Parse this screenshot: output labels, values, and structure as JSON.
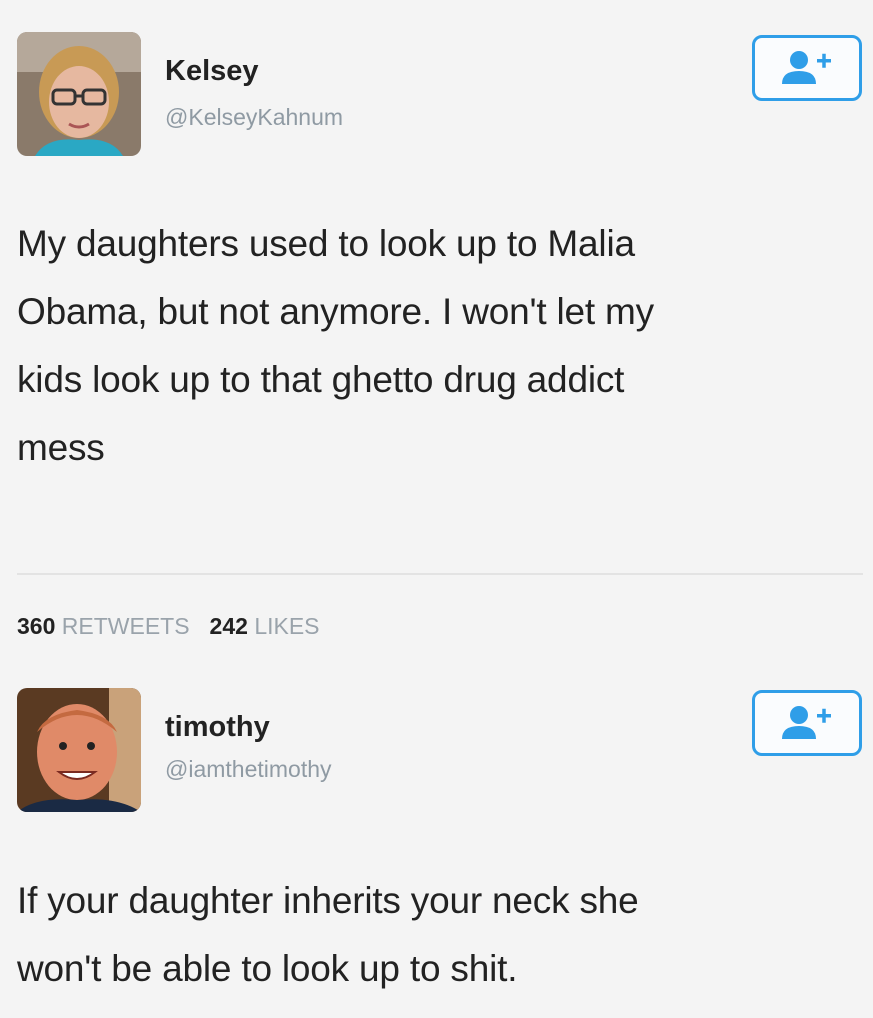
{
  "tweets": [
    {
      "author": {
        "name": "Kelsey",
        "handle": "@KelseyKahnum"
      },
      "follow_icon": "follow-user-icon",
      "text_lines": [
        "My daughters used to look up to Malia",
        "Obama, but not anymore. I won't let my",
        "kids look up to that ghetto drug addict",
        "mess"
      ],
      "stats": {
        "retweets_count": "360",
        "retweets_label": "RETWEETS",
        "likes_count": "242",
        "likes_label": "LIKES"
      }
    },
    {
      "author": {
        "name": "timothy",
        "handle": "@iamthetimothy"
      },
      "follow_icon": "follow-user-icon",
      "text_lines": [
        "If your daughter inherits your neck she",
        "won't be able to look up to shit."
      ]
    }
  ],
  "colors": {
    "accent": "#2f9ee8",
    "muted": "#8f9aa3",
    "background": "#f4f4f4"
  }
}
